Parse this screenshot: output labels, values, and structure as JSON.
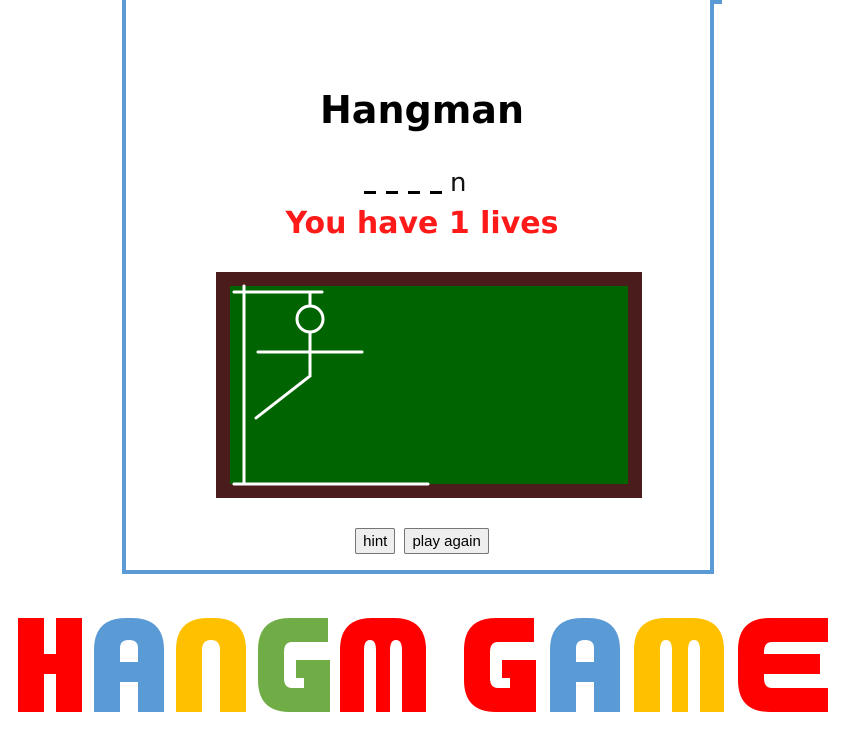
{
  "game": {
    "title": "Hangman",
    "word_slots": [
      "_",
      "_",
      "_",
      "_",
      "n"
    ],
    "lives_text": "You have 1 lives",
    "lives_remaining": 1
  },
  "buttons": {
    "hint_label": "hint",
    "play_again_label": "play again"
  },
  "logo": {
    "text": "HANGM GAME",
    "letters": [
      {
        "ch": "H",
        "color": "#ff0000"
      },
      {
        "ch": "A",
        "color": "#5b9bd5"
      },
      {
        "ch": "N",
        "color": "#ffc000"
      },
      {
        "ch": "G",
        "color": "#70ad47"
      },
      {
        "ch": "M",
        "color": "#ff0000"
      },
      {
        "ch": " ",
        "color": "#ffffff"
      },
      {
        "ch": "G",
        "color": "#ff0000"
      },
      {
        "ch": "A",
        "color": "#5b9bd5"
      },
      {
        "ch": "M",
        "color": "#ffc000"
      },
      {
        "ch": "E",
        "color": "#ff0000"
      }
    ]
  },
  "colors": {
    "panel_border": "#5b9bd5",
    "board_frame": "#4a1c1c",
    "board_surface": "#006400",
    "chalk": "#ffffff",
    "lives_text": "#ff1a1a"
  },
  "icons": {
    "gallows": "gallows-drawing",
    "stick_figure": "hangman-figure"
  }
}
